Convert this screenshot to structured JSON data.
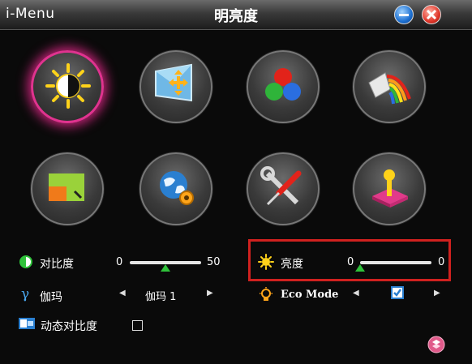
{
  "titlebar": {
    "app_name": "i-Menu",
    "title": "明亮度"
  },
  "icons": [
    {
      "name": "brightness-contrast",
      "active": true
    },
    {
      "name": "image-position",
      "active": false
    },
    {
      "name": "color",
      "active": false
    },
    {
      "name": "picture-boost",
      "active": false
    },
    {
      "name": "pip",
      "active": false
    },
    {
      "name": "setup",
      "active": false
    },
    {
      "name": "extra",
      "active": false
    },
    {
      "name": "reset",
      "active": false
    }
  ],
  "settings": {
    "contrast": {
      "label": "对比度",
      "min": "0",
      "value": "50",
      "level": 0.5
    },
    "gamma": {
      "label": "伽玛",
      "value": "伽玛 1"
    },
    "dcr": {
      "label": "动态对比度",
      "checked": false
    },
    "brightness": {
      "label": "亮度",
      "min": "0",
      "value": "0",
      "level": 0.0
    },
    "eco": {
      "label": "Eco Mode",
      "checked": true
    }
  },
  "colors": {
    "active_ring": "#e0338f",
    "highlight": "#d0211f",
    "slider_thumb": "#2fc23a",
    "accent_blue": "#2a7fd0"
  }
}
